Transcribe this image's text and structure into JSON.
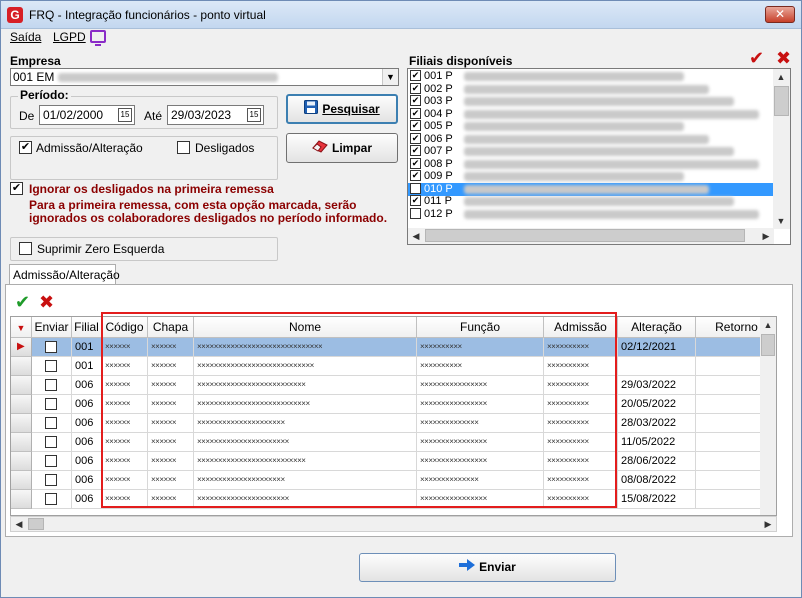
{
  "window": {
    "title": "FRQ - Integração funcionários - ponto virtual",
    "icon_letter": "G",
    "close_glyph": "✕"
  },
  "menu": {
    "items": [
      "Saída",
      "LGPD"
    ]
  },
  "empresa": {
    "label": "Empresa",
    "value_prefix": "001 EM"
  },
  "periodo": {
    "label": "Período:",
    "de_label": "De",
    "de_value": "01/02/2000",
    "ate_label": "Até",
    "ate_value": "29/03/2023"
  },
  "buttons": {
    "pesquisar": "Pesquisar",
    "limpar": "Limpar",
    "enviar": "Enviar"
  },
  "filters": {
    "admissao": "Admissão/Alteração",
    "desligados": "Desligados",
    "suprimir": "Suprimir Zero Esquerda"
  },
  "ignorar": {
    "label": "Ignorar os desligados na primeira remessa",
    "desc_line1": "Para a primeira remessa, com esta opção marcada, serão",
    "desc_line2": "ignorados os colaboradores desligados no período informado."
  },
  "filiais": {
    "label": "Filiais disponíveis",
    "items": [
      {
        "code": "001 P",
        "checked": true,
        "selected": false
      },
      {
        "code": "002 P",
        "checked": true,
        "selected": false
      },
      {
        "code": "003 P",
        "checked": true,
        "selected": false
      },
      {
        "code": "004 P",
        "checked": true,
        "selected": false
      },
      {
        "code": "005 P",
        "checked": true,
        "selected": false
      },
      {
        "code": "006 P",
        "checked": true,
        "selected": false
      },
      {
        "code": "007 P",
        "checked": true,
        "selected": false
      },
      {
        "code": "008 P",
        "checked": true,
        "selected": false
      },
      {
        "code": "009 P",
        "checked": true,
        "selected": false
      },
      {
        "code": "010 P",
        "checked": true,
        "selected": true
      },
      {
        "code": "011 P",
        "checked": true,
        "selected": false
      },
      {
        "code": "012 P",
        "checked": false,
        "selected": false
      }
    ]
  },
  "tab": {
    "label": "Admissão/Alteração"
  },
  "grid": {
    "columns": [
      "Enviar",
      "Filial",
      "Código",
      "Chapa",
      "Nome",
      "Função",
      "Admissão",
      "Alteração",
      "Retorno"
    ],
    "rows": [
      {
        "filial": "001",
        "codigo": "××××××",
        "chapa": "××××××",
        "nome": "××××××××××××××××××××××××××××××",
        "funcao": "××××××××××",
        "admissao": "××××××××××",
        "alteracao": "02/12/2021",
        "selected": true
      },
      {
        "filial": "001",
        "codigo": "××××××",
        "chapa": "××××××",
        "nome": "××××××××××××××××××××××××××××",
        "funcao": "××××××××××",
        "admissao": "××××××××××",
        "alteracao": "",
        "selected": false
      },
      {
        "filial": "006",
        "codigo": "××××××",
        "chapa": "××××××",
        "nome": "××××××××××××××××××××××××××",
        "funcao": "××××××××××××××××",
        "admissao": "××××××××××",
        "alteracao": "29/03/2022",
        "selected": false
      },
      {
        "filial": "006",
        "codigo": "××××××",
        "chapa": "××××××",
        "nome": "×××××××××××××××××××××××××××",
        "funcao": "××××××××××××××××",
        "admissao": "××××××××××",
        "alteracao": "20/05/2022",
        "selected": false
      },
      {
        "filial": "006",
        "codigo": "××××××",
        "chapa": "××××××",
        "nome": "×××××××××××××××××××××",
        "funcao": "××××××××××××××",
        "admissao": "××××××××××",
        "alteracao": "28/03/2022",
        "selected": false
      },
      {
        "filial": "006",
        "codigo": "××××××",
        "chapa": "××××××",
        "nome": "××××××××××××××××××××××",
        "funcao": "××××××××××××××××",
        "admissao": "××××××××××",
        "alteracao": "11/05/2022",
        "selected": false
      },
      {
        "filial": "006",
        "codigo": "××××××",
        "chapa": "××××××",
        "nome": "××××××××××××××××××××××××××",
        "funcao": "××××××××××××××××",
        "admissao": "××××××××××",
        "alteracao": "28/06/2022",
        "selected": false
      },
      {
        "filial": "006",
        "codigo": "××××××",
        "chapa": "××××××",
        "nome": "×××××××××××××××××××××",
        "funcao": "××××××××××××××",
        "admissao": "××××××××××",
        "alteracao": "08/08/2022",
        "selected": false
      },
      {
        "filial": "006",
        "codigo": "××××××",
        "chapa": "××××××",
        "nome": "××××××××××××××××××××××",
        "funcao": "××××××××××××××××",
        "admissao": "××××××××××",
        "alteracao": "15/08/2022",
        "selected": false
      }
    ]
  },
  "colors": {
    "accent_red": "#e31d1d",
    "selection_blue": "#3399ff",
    "row_selected": "#9cbde3",
    "warning_text": "#8b0000",
    "confirm_green": "#1f9b2a"
  },
  "icons": {
    "confirm": "check-icon",
    "cancel": "x-icon",
    "search": "floppy-disk-icon",
    "clear": "eraser-icon",
    "send": "arrow-right-icon"
  }
}
